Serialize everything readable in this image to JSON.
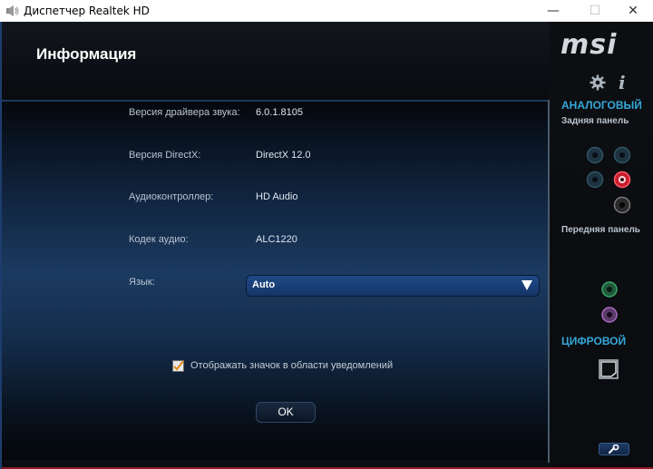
{
  "window": {
    "title": "Диспетчер Realtek HD",
    "minimize_glyph": "—",
    "maximize_glyph": "☐",
    "close_glyph": "✕"
  },
  "page": {
    "title": "Информация"
  },
  "info": {
    "rows": [
      {
        "label": "Версия драйвера звука:",
        "value": "6.0.1.8105"
      },
      {
        "label": "Версия DirectX:",
        "value": "DirectX 12.0"
      },
      {
        "label": "Аудиоконтроллер:",
        "value": "HD Audio"
      },
      {
        "label": "Кодек аудио:",
        "value": "ALC1220"
      }
    ],
    "language_label": "Язык:",
    "language_value": "Auto"
  },
  "tray_checkbox": {
    "label": "Отображать значок в области уведомлений",
    "checked": true
  },
  "ok_label": "OK",
  "sidebar": {
    "brand": "msi",
    "analog_title": "АНАЛОГОВЫЙ",
    "rear_panel": "Задняя панель",
    "front_panel": "Передняя панель",
    "digital_title": "ЦИФРОВОЙ"
  },
  "icons": {
    "app": "speaker-icon",
    "settings": "gear-icon",
    "information": "info-icon",
    "dropdown": "triangle-down-icon",
    "spdif": "spdif-port-icon",
    "tools": "wrench-icon"
  },
  "colors": {
    "accent": "#35a7d8",
    "jack_active": "#e0283a",
    "jack_front_green": "#3aa86a",
    "jack_front_pink": "#a86ac0"
  }
}
